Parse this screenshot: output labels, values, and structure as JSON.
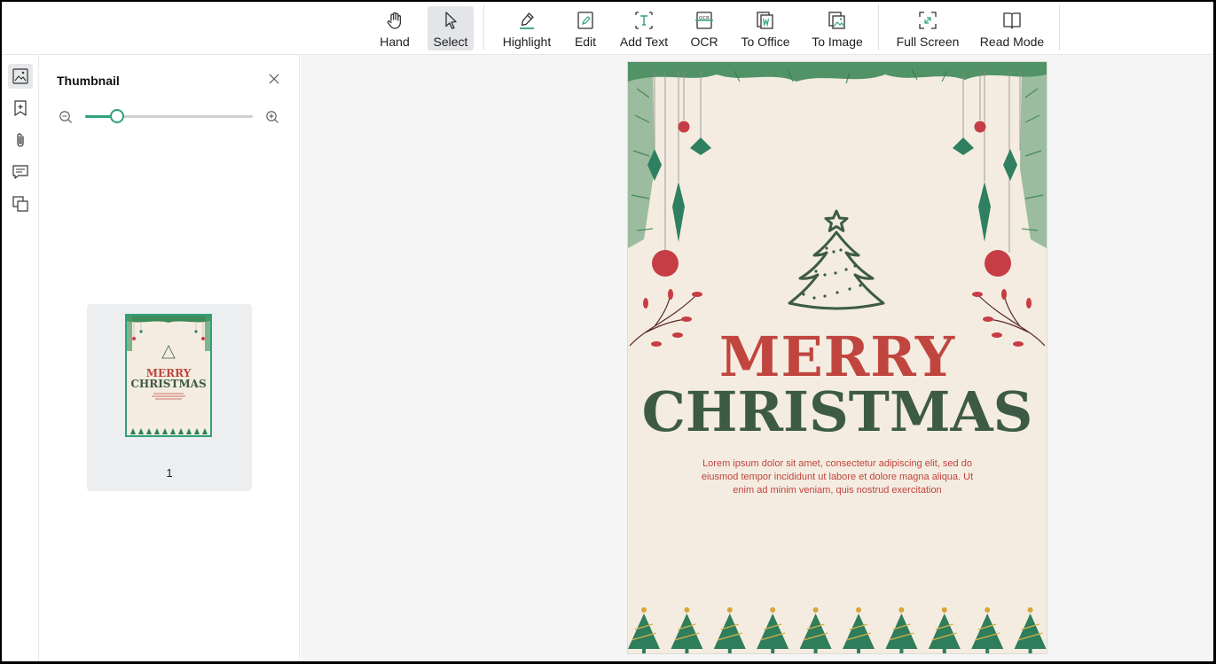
{
  "toolbar": {
    "tools": [
      {
        "id": "hand",
        "label": "Hand",
        "icon": "hand-icon",
        "active": false
      },
      {
        "id": "select",
        "label": "Select",
        "icon": "cursor-icon",
        "active": true
      },
      {
        "id": "highlight",
        "label": "Highlight",
        "icon": "highlighter-icon",
        "active": false
      },
      {
        "id": "edit",
        "label": "Edit",
        "icon": "edit-icon",
        "active": false
      },
      {
        "id": "add_text",
        "label": "Add Text",
        "icon": "text-box-icon",
        "active": false
      },
      {
        "id": "ocr",
        "label": "OCR",
        "icon": "ocr-icon",
        "active": false
      },
      {
        "id": "to_office",
        "label": "To Office",
        "icon": "word-doc-icon",
        "active": false
      },
      {
        "id": "to_image",
        "label": "To Image",
        "icon": "image-convert-icon",
        "active": false
      },
      {
        "id": "full_screen",
        "label": "Full Screen",
        "icon": "fullscreen-icon",
        "active": false
      },
      {
        "id": "read_mode",
        "label": "Read Mode",
        "icon": "book-icon",
        "active": false
      }
    ]
  },
  "sidebar": {
    "icons": [
      "thumbnail-icon",
      "bookmark-icon",
      "attachment-icon",
      "comment-icon",
      "layers-icon"
    ],
    "active": "thumbnail-icon"
  },
  "thumbnail_panel": {
    "title": "Thumbnail",
    "zoom_fraction": 0.19,
    "pages": [
      {
        "number": "1"
      }
    ]
  },
  "document": {
    "heading_line1": "MERRY",
    "heading_line2": "CHRISTMAS",
    "body": "Lorem ipsum dolor sit amet, consectetur adipiscing elit, sed do eiusmod tempor incididunt ut labore et dolore magna aliqua. Ut enim ad minim veniam, quis nostrud exercitation"
  },
  "colors": {
    "accent": "#2ea37b",
    "red": "#c0453f",
    "green": "#3d5b44",
    "page_bg": "#f4ece0"
  }
}
